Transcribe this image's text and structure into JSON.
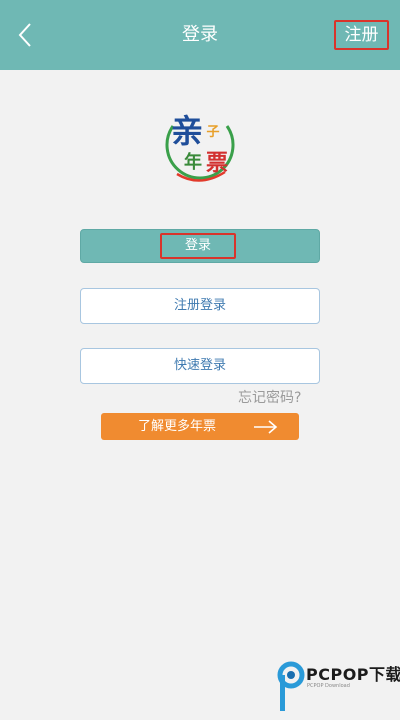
{
  "header": {
    "back_icon": "chevron-left-icon",
    "title": "登录",
    "register_label": "注册"
  },
  "logo": {
    "chars": [
      "亲",
      "子",
      "年",
      "票"
    ]
  },
  "buttons": {
    "login": "登录",
    "register_login": "注册登录",
    "quick_login": "快速登录"
  },
  "forgot_password": "忘记密码?",
  "promo": {
    "label": "了解更多年票",
    "icon": "arrow-right-icon"
  },
  "watermark": {
    "brand": "PCPOP下载",
    "small": "PCPOP Download"
  },
  "colors": {
    "header_bg": "#6fb8b4",
    "highlight_border": "#d9342b",
    "promo_bg": "#f08b30",
    "outline_text": "#3f7ab0"
  }
}
